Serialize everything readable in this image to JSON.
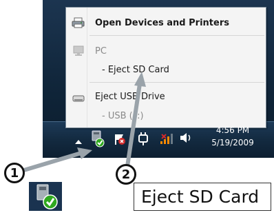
{
  "menu": {
    "items": [
      {
        "label": "Open Devices and Printers",
        "icon": "printer-icon"
      },
      {
        "label": "PC",
        "icon": "pc-icon"
      },
      {
        "label": "- Eject SD Card"
      },
      {
        "label": "Eject USB Drive",
        "icon": "drive-icon"
      },
      {
        "label": "- USB (F:)"
      }
    ]
  },
  "clock": {
    "time": "4:56 PM",
    "date": "5/19/2009"
  },
  "callouts": {
    "one": "1",
    "two": "2"
  },
  "zoom": {
    "label": "Eject SD Card"
  },
  "colors": {
    "taskbar": "#132a40",
    "menu_bg": "#f4f4f4",
    "arrow": "#9aa3aa",
    "check": "#2fa81f"
  }
}
